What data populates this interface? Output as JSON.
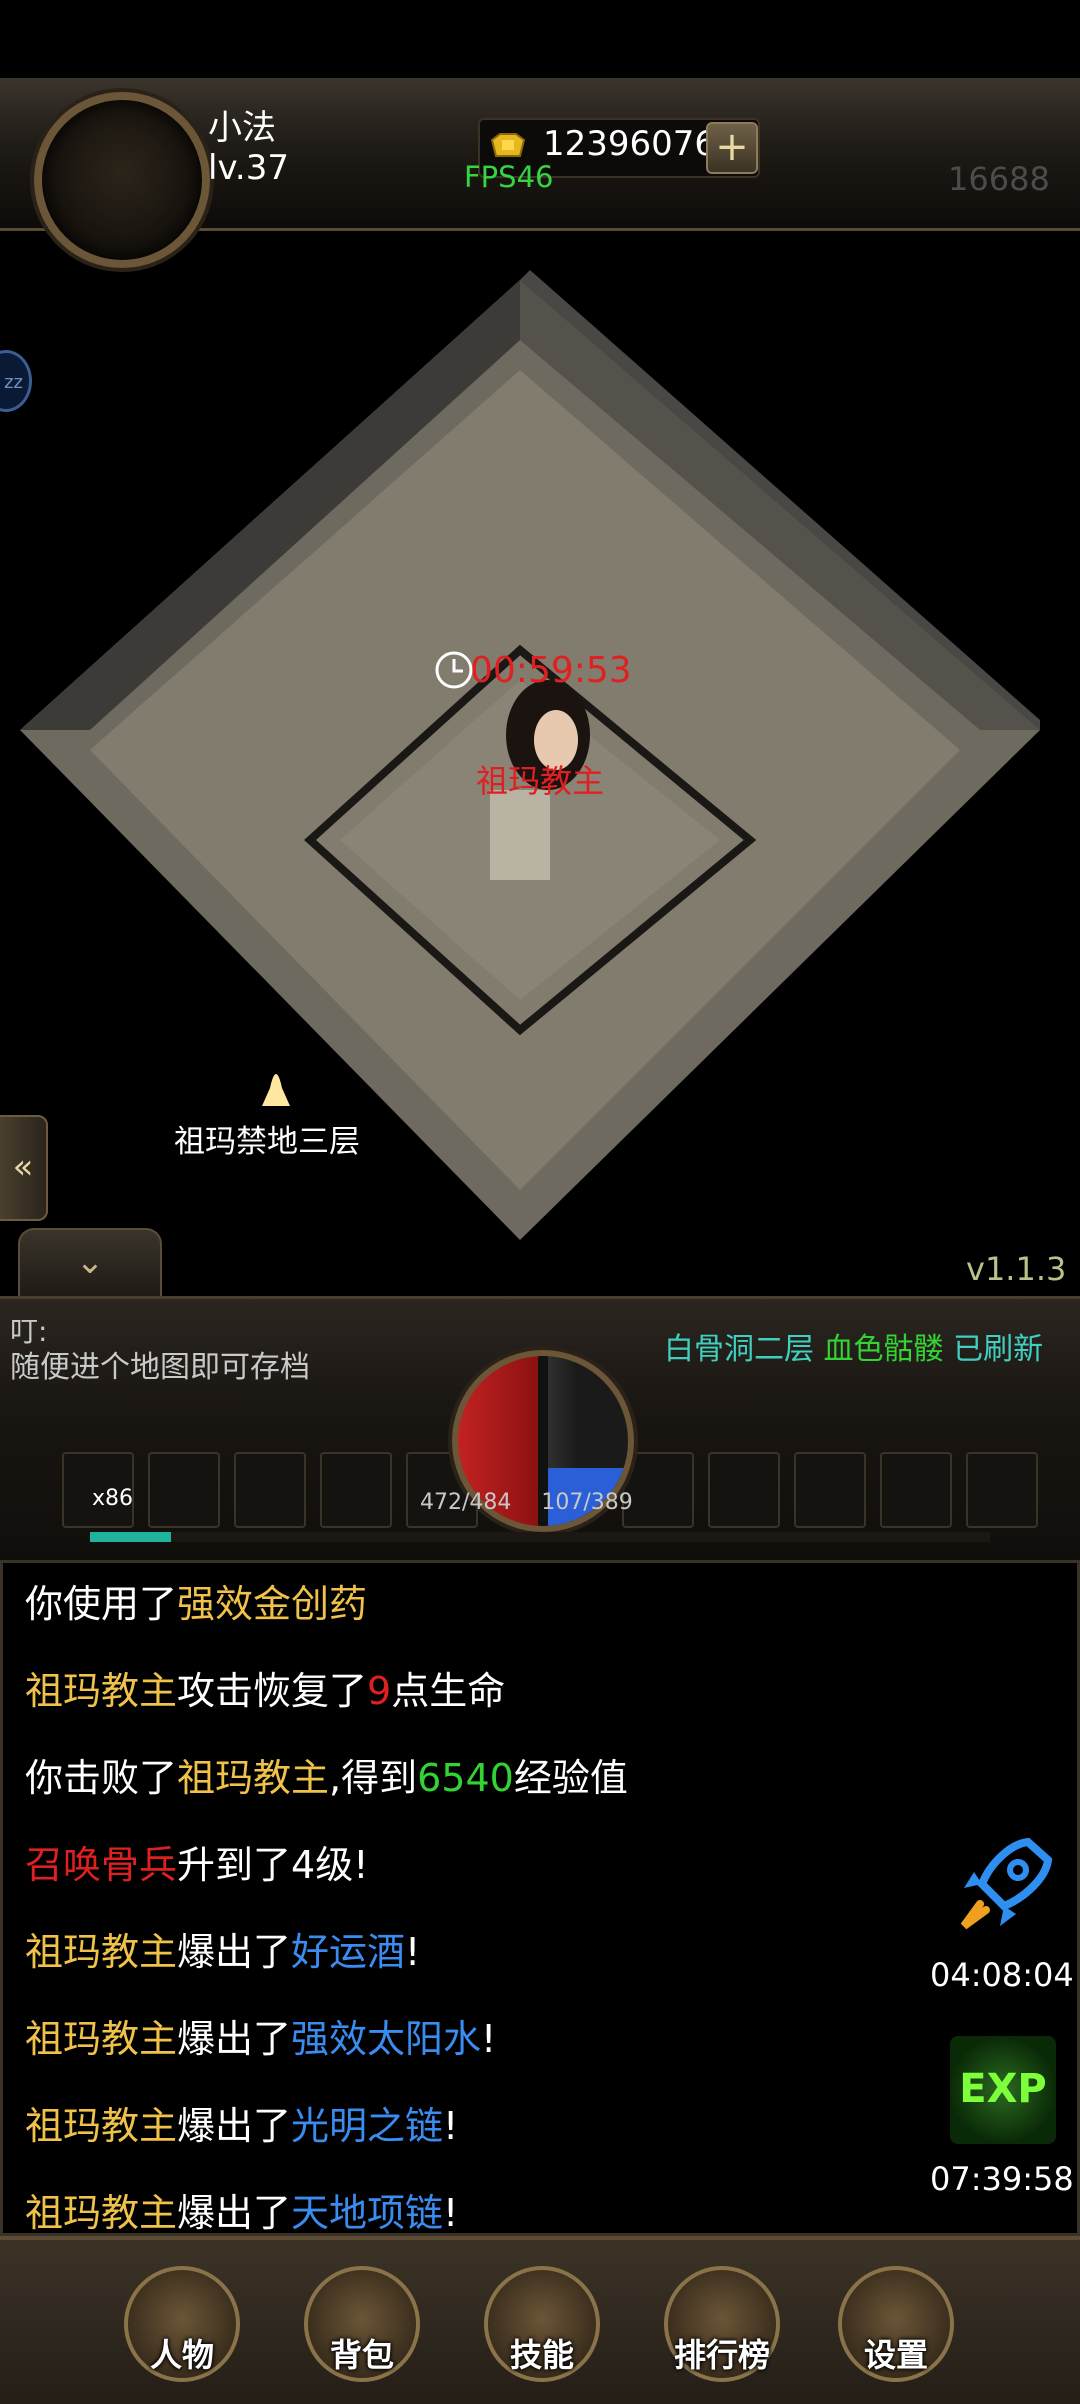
{
  "player": {
    "name": "小法",
    "level": "lv.37",
    "gold": "12396076",
    "plus": "+",
    "fps": "FPS46",
    "server_no": "16688"
  },
  "map": {
    "timer": "00:59:53",
    "boss_name": "祖玛教主",
    "portal_label": "祖玛禁地三层",
    "version": "v1.1.3"
  },
  "side": {
    "zz_label": "zz",
    "collapse_glyph": "«",
    "dropdown_glyph": "⌄"
  },
  "tip": {
    "title": "叮:",
    "text": "随便进个地图即可存档"
  },
  "notice": {
    "place": "白骨洞二层",
    "monster": "血色骷髅",
    "status": "已刷新"
  },
  "skillbar": {
    "first_slot_count": "x86",
    "hp": "472/484",
    "mp": "107/389",
    "exp_fraction": 0.09
  },
  "chat": [
    [
      {
        "t": "你使用了",
        "c": "w"
      },
      {
        "t": "强效金创药",
        "c": "y"
      }
    ],
    [
      {
        "t": "祖玛教主",
        "c": "y"
      },
      {
        "t": "攻击恢复了",
        "c": "w"
      },
      {
        "t": "9",
        "c": "r"
      },
      {
        "t": "点生命",
        "c": "w"
      }
    ],
    [
      {
        "t": "你击败了",
        "c": "w"
      },
      {
        "t": "祖玛教主",
        "c": "y"
      },
      {
        "t": ",得到",
        "c": "w"
      },
      {
        "t": "6540",
        "c": "g"
      },
      {
        "t": "经验值",
        "c": "w"
      }
    ],
    [
      {
        "t": "召唤骨兵",
        "c": "r"
      },
      {
        "t": "升到了4级!",
        "c": "w"
      }
    ],
    [
      {
        "t": "祖玛教主",
        "c": "y"
      },
      {
        "t": "爆出了",
        "c": "w"
      },
      {
        "t": "好运酒",
        "c": "b"
      },
      {
        "t": "!",
        "c": "w"
      }
    ],
    [
      {
        "t": "祖玛教主",
        "c": "y"
      },
      {
        "t": "爆出了",
        "c": "w"
      },
      {
        "t": "强效太阳水",
        "c": "b"
      },
      {
        "t": "!",
        "c": "w"
      }
    ],
    [
      {
        "t": "祖玛教主",
        "c": "y"
      },
      {
        "t": "爆出了",
        "c": "w"
      },
      {
        "t": "光明之链",
        "c": "b"
      },
      {
        "t": "!",
        "c": "w"
      }
    ],
    [
      {
        "t": "祖玛教主",
        "c": "y"
      },
      {
        "t": "爆出了",
        "c": "w"
      },
      {
        "t": "天地项链",
        "c": "b"
      },
      {
        "t": "!",
        "c": "w"
      }
    ]
  ],
  "boosts": {
    "rocket_time": "04:08:04",
    "exp_label": "EXP",
    "exp_time": "07:39:58"
  },
  "nav": [
    {
      "label": "人物",
      "icon": "character-icon"
    },
    {
      "label": "背包",
      "icon": "bag-icon"
    },
    {
      "label": "技能",
      "icon": "skill-icon"
    },
    {
      "label": "排行榜",
      "icon": "ranking-icon"
    },
    {
      "label": "设置",
      "icon": "settings-gear-icon"
    }
  ],
  "colors": {
    "red": "#e02020",
    "yellow": "#f0c24a",
    "green": "#33d333",
    "blue": "#3a8cf0",
    "fps_green": "#36d43f"
  }
}
